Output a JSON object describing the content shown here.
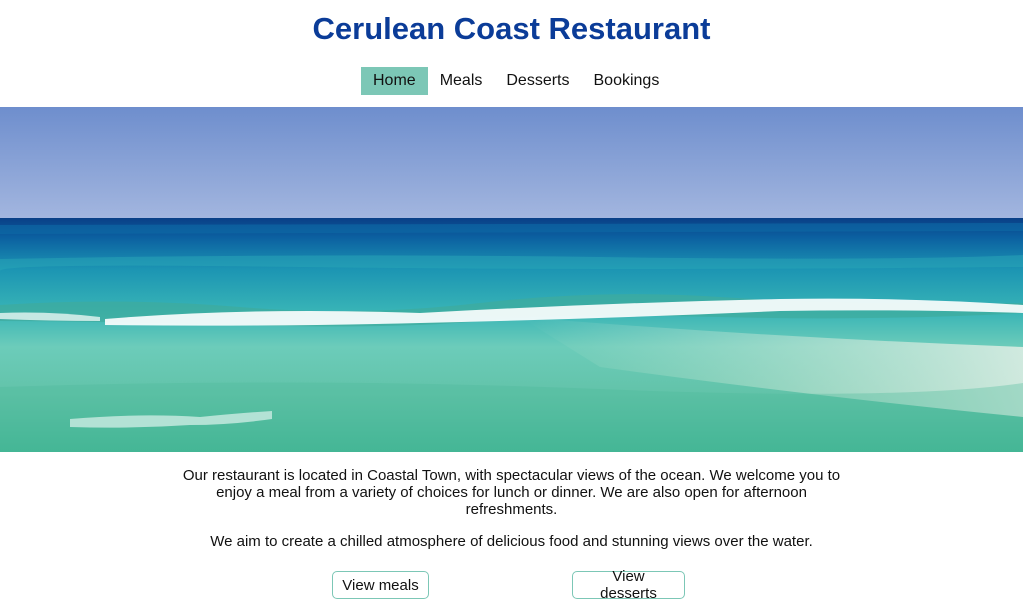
{
  "header": {
    "title": "Cerulean Coast Restaurant"
  },
  "nav": {
    "items": [
      {
        "label": "Home",
        "active": true
      },
      {
        "label": "Meals",
        "active": false
      },
      {
        "label": "Desserts",
        "active": false
      },
      {
        "label": "Bookings",
        "active": false
      }
    ]
  },
  "hero": {
    "image_subject": "ocean-beach-photo",
    "colors": {
      "sky_top": "#6f8fce",
      "sky_horizon": "#9fb2de",
      "deep_sea": "#0a4f8f",
      "mid_sea": "#1d9bb5",
      "shallow": "#58c7b8",
      "foam": "#f4fbfb",
      "sand_water": "#a9ddc9"
    }
  },
  "main": {
    "intro": "Our restaurant is located in Coastal Town, with spectacular views of the ocean. We welcome you to enjoy a meal from a variety of choices for lunch or dinner. We are also open for afternoon refreshments.",
    "aim": "We aim to create a chilled atmosphere of delicious food and stunning views over the water."
  },
  "buttons": {
    "meals_label": "View meals",
    "desserts_label": "View desserts"
  },
  "colors": {
    "title": "#0b3c98",
    "accent": "#7cc7b6",
    "text": "#111111"
  }
}
